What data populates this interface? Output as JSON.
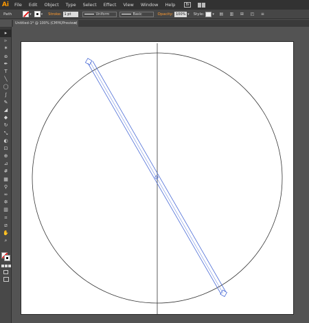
{
  "app": {
    "logo": "Ai"
  },
  "menu": {
    "items": [
      "File",
      "Edit",
      "Object",
      "Type",
      "Select",
      "Effect",
      "View",
      "Window",
      "Help"
    ],
    "bridge_label": "Br"
  },
  "control_bar": {
    "selection_label": "Path",
    "stroke_label": "Stroke:",
    "stroke_weight": "1 pt",
    "profile": "Uniform",
    "brush": "Basic",
    "opacity_label": "Opacity:",
    "opacity_value": "100%",
    "style_label": "Style:"
  },
  "document": {
    "tab_title": "Untitled-1* @ 100% (CMYK/Preview)",
    "close_glyph": "×"
  },
  "colors": {
    "selection": "#4a6bd6",
    "menubar_bg": "#323232",
    "panel_bg": "#464646",
    "canvas_bg": "#535353",
    "accent": "#ff9a2e"
  },
  "tools": [
    {
      "name": "selection-tool-icon",
      "glyph": "▸",
      "active": true
    },
    {
      "name": "direct-selection-tool-icon",
      "glyph": "▹"
    },
    {
      "name": "magic-wand-tool-icon",
      "glyph": "✶"
    },
    {
      "name": "lasso-tool-icon",
      "glyph": "ɷ"
    },
    {
      "name": "pen-tool-icon",
      "glyph": "✒"
    },
    {
      "name": "type-tool-icon",
      "glyph": "T"
    },
    {
      "name": "line-segment-tool-icon",
      "glyph": "╲"
    },
    {
      "name": "ellipse-tool-icon",
      "glyph": "◯"
    },
    {
      "name": "paintbrush-tool-icon",
      "glyph": "∫"
    },
    {
      "name": "pencil-tool-icon",
      "glyph": "✎"
    },
    {
      "name": "blob-brush-tool-icon",
      "glyph": "◢"
    },
    {
      "name": "eraser-tool-icon",
      "glyph": "◆"
    },
    {
      "name": "rotate-tool-icon",
      "glyph": "↻"
    },
    {
      "name": "scale-tool-icon",
      "glyph": "⤡"
    },
    {
      "name": "warp-tool-icon",
      "glyph": "◐"
    },
    {
      "name": "free-transform-tool-icon",
      "glyph": "⊡"
    },
    {
      "name": "shape-builder-tool-icon",
      "glyph": "⊕"
    },
    {
      "name": "perspective-grid-tool-icon",
      "glyph": "⊿"
    },
    {
      "name": "mesh-tool-icon",
      "glyph": "#"
    },
    {
      "name": "gradient-tool-icon",
      "glyph": "▦"
    },
    {
      "name": "eyedropper-tool-icon",
      "glyph": "⚲"
    },
    {
      "name": "blend-tool-icon",
      "glyph": "∞"
    },
    {
      "name": "symbol-sprayer-tool-icon",
      "glyph": "✲"
    },
    {
      "name": "column-graph-tool-icon",
      "glyph": "▥"
    },
    {
      "name": "artboard-tool-icon",
      "glyph": "⌗"
    },
    {
      "name": "slice-tool-icon",
      "glyph": "⧄"
    },
    {
      "name": "hand-tool-icon",
      "glyph": "✋"
    },
    {
      "name": "zoom-tool-icon",
      "glyph": "⌕"
    }
  ]
}
